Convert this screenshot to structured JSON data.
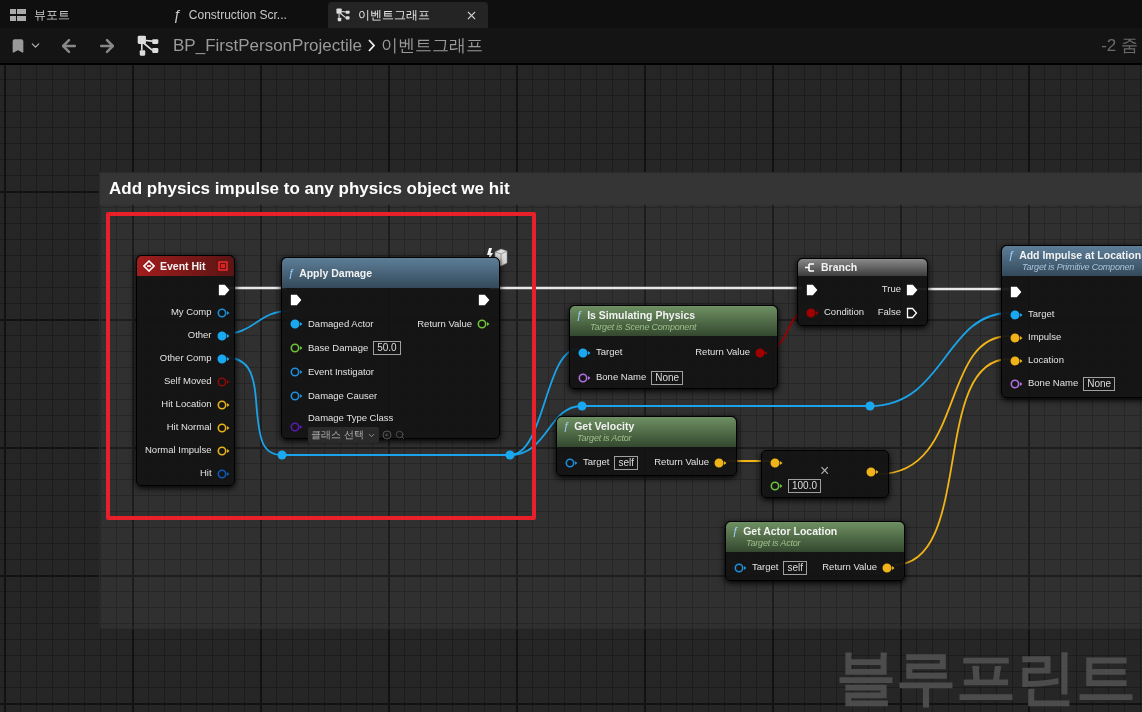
{
  "tabs": [
    {
      "label": "뷰포트",
      "selected": false,
      "closable": false
    },
    {
      "label": "Construction Scr...",
      "glyph": "ƒ",
      "selected": false,
      "closable": false
    },
    {
      "label": "이벤트그래프",
      "selected": true,
      "closable": true
    }
  ],
  "toolbar": {
    "breadcrumb": [
      "BP_FirstPersonProjectile",
      "이벤트그래프"
    ],
    "zoom": "-2 줌"
  },
  "comment": {
    "title": "Add physics impulse to any physics object we hit"
  },
  "nodes": [
    {
      "kind": "event",
      "title": "Event Hit",
      "outputs": [
        {
          "kind": "exec",
          "connected": true
        },
        {
          "kind": "data",
          "label": "My Comp",
          "color": "#1d8fd8",
          "connected": false
        },
        {
          "kind": "data",
          "label": "Other",
          "color": "#1aa8f0",
          "connected": true
        },
        {
          "kind": "data",
          "label": "Other Comp",
          "color": "#1aa8f0",
          "connected": true
        },
        {
          "kind": "data",
          "label": "Self Moved",
          "color": "#8b0a0a",
          "connected": false
        },
        {
          "kind": "data",
          "label": "Hit Location",
          "color": "#e8b21a",
          "connected": false
        },
        {
          "kind": "data",
          "label": "Hit Normal",
          "color": "#e8b21a",
          "connected": false
        },
        {
          "kind": "data",
          "label": "Normal Impulse",
          "color": "#e8b21a",
          "connected": false
        },
        {
          "kind": "data",
          "label": "Hit",
          "color": "#0d5bb8",
          "connected": false
        }
      ]
    },
    {
      "kind": "function",
      "glyph": "ƒ",
      "title": "Apply Damage",
      "networked": true,
      "inputs": [
        {
          "kind": "exec",
          "connected": true
        },
        {
          "kind": "data",
          "label": "Damaged Actor",
          "color": "#1aa8f0",
          "connected": true
        },
        {
          "kind": "data",
          "label": "Base Damage",
          "color": "#6fc13a",
          "connected": false,
          "value": "50.0"
        },
        {
          "kind": "data",
          "label": "Event Instigator",
          "color": "#1d8fd8",
          "connected": false
        },
        {
          "kind": "data",
          "label": "Damage Causer",
          "color": "#1d8fd8",
          "connected": false
        },
        {
          "kind": "data",
          "label": "Damage Type Class",
          "color": "#5a1ab0",
          "connected": false,
          "picker": "클래스 선택"
        }
      ],
      "outputs": [
        {
          "kind": "exec",
          "connected": true
        },
        {
          "kind": "data",
          "label": "Return Value",
          "color": "#6fc13a",
          "connected": false
        }
      ]
    },
    {
      "kind": "pure",
      "glyph": "ƒ",
      "title": "Is Simulating Physics",
      "subtitle": "Target is Scene Component",
      "inputs": [
        {
          "kind": "data",
          "label": "Target",
          "color": "#1aa8f0",
          "connected": true
        },
        {
          "kind": "data",
          "label": "Bone Name",
          "color": "#b070e0",
          "connected": false,
          "value": "None"
        }
      ],
      "outputs": [
        {
          "kind": "data",
          "label": "Return Value",
          "color": "#a00000",
          "connected": true
        }
      ]
    },
    {
      "kind": "macro",
      "title": "Branch",
      "inputs": [
        {
          "kind": "exec",
          "connected": true
        },
        {
          "kind": "data",
          "label": "Condition",
          "color": "#a00000",
          "connected": true
        }
      ],
      "outputs": [
        {
          "kind": "exec",
          "label": "True",
          "connected": true
        },
        {
          "kind": "exec",
          "label": "False",
          "connected": false
        }
      ]
    },
    {
      "kind": "pure",
      "glyph": "ƒ",
      "title": "Get Velocity",
      "subtitle": "Target is Actor",
      "inputs": [
        {
          "kind": "data",
          "label": "Target",
          "color": "#1d8fd8",
          "connected": false,
          "value": "self"
        }
      ],
      "outputs": [
        {
          "kind": "data",
          "label": "Return Value",
          "color": "#f0b418",
          "connected": true
        }
      ]
    },
    {
      "kind": "operator",
      "glyph": "×",
      "inputs": [
        {
          "kind": "data",
          "color": "#f0b418",
          "connected": true
        },
        {
          "kind": "data",
          "color": "#6fc13a",
          "connected": false,
          "value": "100.0"
        }
      ],
      "outputs": [
        {
          "kind": "data",
          "color": "#f0b418",
          "connected": true
        }
      ]
    },
    {
      "kind": "pure",
      "glyph": "ƒ",
      "title": "Get Actor Location",
      "subtitle": "Target is Actor",
      "inputs": [
        {
          "kind": "data",
          "label": "Target",
          "color": "#1d8fd8",
          "connected": false,
          "value": "self"
        }
      ],
      "outputs": [
        {
          "kind": "data",
          "label": "Return Value",
          "color": "#f0b418",
          "connected": true
        }
      ]
    },
    {
      "kind": "function",
      "glyph": "ƒ",
      "title": "Add Impulse at Location",
      "subtitle": "Target is Primitive Componen",
      "inputs": [
        {
          "kind": "exec",
          "connected": true
        },
        {
          "kind": "data",
          "label": "Target",
          "color": "#1aa8f0",
          "connected": true
        },
        {
          "kind": "data",
          "label": "Impulse",
          "color": "#f0b418",
          "connected": true
        },
        {
          "kind": "data",
          "label": "Location",
          "color": "#f0b418",
          "connected": true
        },
        {
          "kind": "data",
          "label": "Bone Name",
          "color": "#b070e0",
          "connected": false,
          "value": "None"
        }
      ]
    }
  ],
  "graph_label": "블루프린트"
}
